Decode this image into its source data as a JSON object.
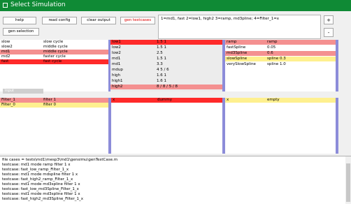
{
  "window": {
    "title": "Select Simulation"
  },
  "toolbar": {
    "help": "help",
    "read_config": "read config",
    "clear_output": "clear output",
    "gen_testcases": "gen testcases",
    "gen_selection": "gen selection",
    "plus": "+",
    "minus": "-"
  },
  "info_text": "1=md1, fast 2=low1, high2 3=ramp, md3pline; 4=Filter_1=x",
  "panel1": {
    "rows": [
      {
        "a": "slow",
        "b": "slow cycle",
        "style": "white"
      },
      {
        "a": "slow2",
        "b": "middle cycle",
        "style": "white"
      },
      {
        "a": "md1",
        "b": "middle cycle",
        "style": "pink"
      },
      {
        "a": "md2",
        "b": "faster cycle",
        "style": "white"
      },
      {
        "a": "fast",
        "b": "fast cycle",
        "style": "red"
      }
    ]
  },
  "panel2": {
    "rows": [
      {
        "a": "low1",
        "b": "1.5 1",
        "style": "red"
      },
      {
        "a": "low2",
        "b": "1.5 1",
        "style": "white"
      },
      {
        "a": "low2",
        "b": "2.5",
        "style": "white"
      },
      {
        "a": "md1",
        "b": "1.5 1",
        "style": "white"
      },
      {
        "a": "md1",
        "b": "3.3",
        "style": "white"
      },
      {
        "a": "mdup",
        "b": "4 5 / 6",
        "style": "white"
      },
      {
        "a": "high",
        "b": "1.6 1",
        "style": "white"
      },
      {
        "a": "high1",
        "b": "1.6 1",
        "style": "white"
      },
      {
        "a": "high2",
        "b": "8 / 8 / 5 / 8",
        "style": "pink"
      }
    ]
  },
  "panel3": {
    "rows": [
      {
        "a": "ramp",
        "b": "ramp",
        "style": "pink"
      },
      {
        "a": "fastSpline",
        "b": "0.05",
        "style": "white"
      },
      {
        "a": "md3Spline",
        "b": "0.6",
        "style": "pink"
      },
      {
        "a": "slowSpline",
        "b": "spline 0.3",
        "style": "yellow"
      },
      {
        "a": "verySlowSpline",
        "b": "spline 1.0",
        "style": "white"
      }
    ]
  },
  "lower_input": "input",
  "panel4": {
    "rows": [
      {
        "a": "Filter_1",
        "b": "filter 1",
        "style": "pink"
      },
      {
        "a": "Filter_0",
        "b": "filter 0",
        "style": "yellow"
      }
    ]
  },
  "panel5": {
    "rows": [
      {
        "a": "x",
        "b": "dummy",
        "style": "red"
      }
    ]
  },
  "panel6": {
    "rows": [
      {
        "a": "x",
        "b": "empty",
        "style": "yellow"
      }
    ]
  },
  "output": {
    "lines": [
      "file cases = tests\\md1\\mesp3\\md1\\gensimu\\genTestCase.m",
      "testcase: md1 mode ramp filter 1 x",
      "testcase: fast_low_ramp_Filter_1_x",
      "testcase: md1 mode mdspline filter 1 x",
      "testcase: fast_high2_ramp_Filter_1_x",
      "testcase: md1 mode md3spline filter 1 x",
      "testcase: fast_low_md3Spline_Filter_1_x",
      "testcase: md1 mode md3spline filter 1 x",
      "testcase: fast_high2_md3Spline_Filter_1_x"
    ]
  }
}
